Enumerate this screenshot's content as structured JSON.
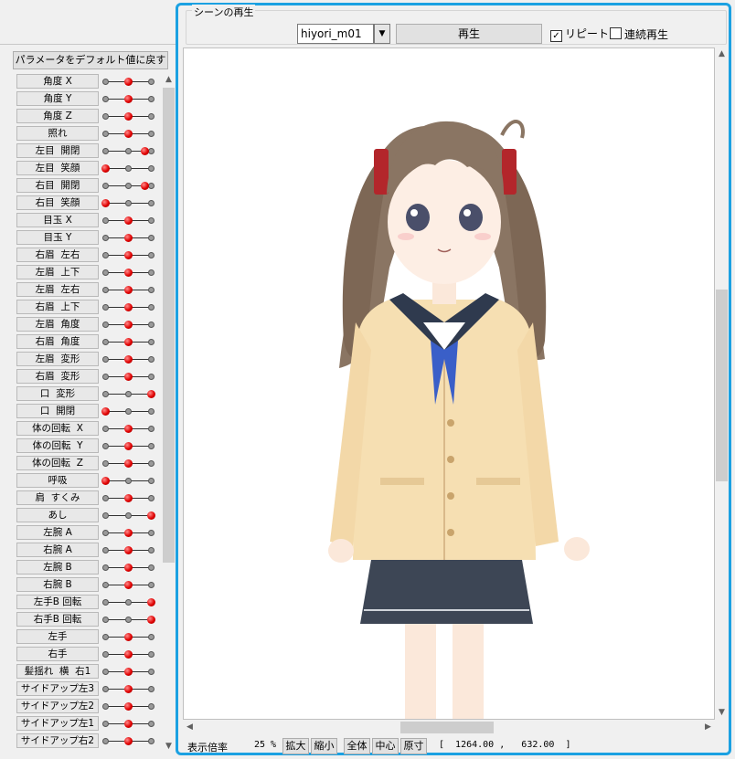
{
  "left_panel": {
    "reset_label": "パラメータをデフォルト値に戻す",
    "scroll_up": "^",
    "scroll_down": "v",
    "params": [
      {
        "label": "角度 X",
        "value": 0.5
      },
      {
        "label": "角度 Y",
        "value": 0.5
      },
      {
        "label": "角度 Z",
        "value": 0.5
      },
      {
        "label": "照れ",
        "value": 0.5
      },
      {
        "label": "左目  開閉",
        "value": 0.85
      },
      {
        "label": "左目  笑顔",
        "value": 0.0
      },
      {
        "label": "右目  開閉",
        "value": 0.85
      },
      {
        "label": "右目  笑顔",
        "value": 0.0
      },
      {
        "label": "目玉 X",
        "value": 0.5
      },
      {
        "label": "目玉 Y",
        "value": 0.5
      },
      {
        "label": "右眉  左右",
        "value": 0.5
      },
      {
        "label": "左眉  上下",
        "value": 0.5
      },
      {
        "label": "左眉  左右",
        "value": 0.5
      },
      {
        "label": "右眉  上下",
        "value": 0.5
      },
      {
        "label": "左眉  角度",
        "value": 0.5
      },
      {
        "label": "右眉  角度",
        "value": 0.5
      },
      {
        "label": "左眉  変形",
        "value": 0.5
      },
      {
        "label": "右眉  変形",
        "value": 0.5
      },
      {
        "label": "口  変形",
        "value": 1.0
      },
      {
        "label": "口  開閉",
        "value": 0.0
      },
      {
        "label": "体の回転  X",
        "value": 0.5
      },
      {
        "label": "体の回転  Y",
        "value": 0.5
      },
      {
        "label": "体の回転  Z",
        "value": 0.5
      },
      {
        "label": "呼吸",
        "value": 0.0
      },
      {
        "label": "肩  すくみ",
        "value": 0.5
      },
      {
        "label": "あし",
        "value": 1.0
      },
      {
        "label": "左腕 A",
        "value": 0.5
      },
      {
        "label": "右腕 A",
        "value": 0.5
      },
      {
        "label": "左腕 B",
        "value": 0.5
      },
      {
        "label": "右腕 B",
        "value": 0.5
      },
      {
        "label": "左手B 回転",
        "value": 1.0
      },
      {
        "label": "右手B 回転",
        "value": 1.0
      },
      {
        "label": "左手",
        "value": 0.5
      },
      {
        "label": "右手",
        "value": 0.5
      },
      {
        "label": "髪揺れ  横  右1",
        "value": 0.5
      },
      {
        "label": "サイドアップ左3",
        "value": 0.5
      },
      {
        "label": "サイドアップ左2",
        "value": 0.5
      },
      {
        "label": "サイドアップ左1",
        "value": 0.5
      },
      {
        "label": "サイドアップ右2",
        "value": 0.5
      }
    ]
  },
  "scene": {
    "group_title": "シーンの再生",
    "selected_scene": "hiyori_m01",
    "play_label": "再生",
    "repeat_label": "リピート",
    "repeat_checked": true,
    "continuous_label": "連続再生",
    "continuous_checked": false
  },
  "status": {
    "zoom_label": "表示倍率",
    "zoom_value": "25 %",
    "zoom_in": "拡大",
    "zoom_out": "縮小",
    "fit_all": "全体",
    "center": "中心",
    "actual_size": "原寸",
    "coords": "[  1264.00 ,   632.00  ]"
  },
  "colors": {
    "panel_border": "#1ba1e2",
    "knob_red": "#e00000"
  }
}
